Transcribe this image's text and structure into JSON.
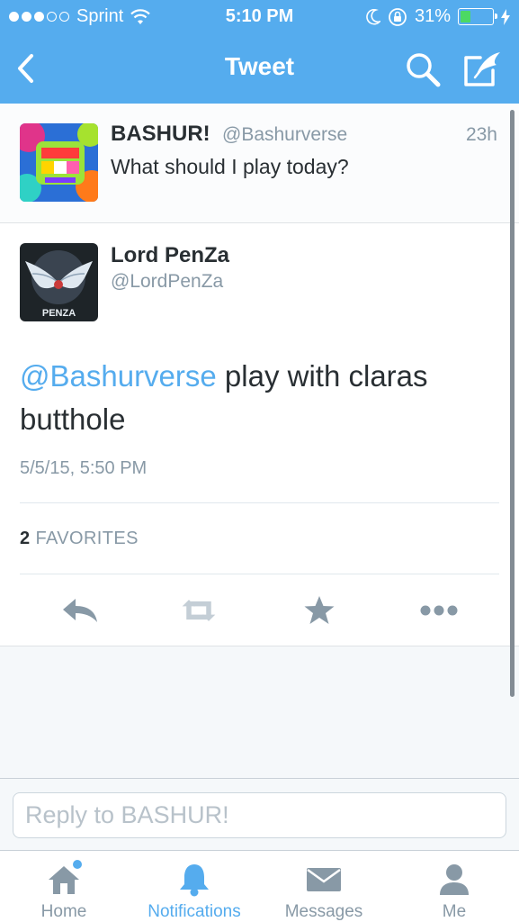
{
  "status_bar": {
    "carrier": "Sprint",
    "time": "5:10 PM",
    "battery": "31%",
    "battery_level": 0.31,
    "signal_bars_filled": 3,
    "signal_bars_total": 5,
    "icons": [
      "wifi-icon",
      "moon-icon",
      "rotation-lock-icon",
      "battery-icon",
      "charging-bolt-icon"
    ]
  },
  "nav": {
    "title": "Tweet",
    "icons": [
      "back-chevron-icon",
      "search-icon",
      "compose-icon"
    ]
  },
  "original_tweet": {
    "name": "BASHUR!",
    "handle": "@Bashurverse",
    "time_ago": "23h",
    "text": "What should I play today?"
  },
  "reply_tweet": {
    "name": "Lord PenZa",
    "handle": "@LordPenZa",
    "avatar_text": "PENZA",
    "mention": "@Bashurverse",
    "text": " play with claras butthole",
    "date": "5/5/15, 5:50 PM",
    "favorites_count": "2",
    "favorites_label": " FAVORITES",
    "action_icons": [
      "reply-icon",
      "retweet-icon",
      "favorite-star-icon",
      "more-icon"
    ]
  },
  "reply_bar": {
    "placeholder": "Reply to BASHUR!"
  },
  "tabs": [
    {
      "label": "Home",
      "icon": "home-icon",
      "active": false,
      "has_dot": true
    },
    {
      "label": "Notifications",
      "icon": "bell-icon",
      "active": true,
      "has_dot": false
    },
    {
      "label": "Messages",
      "icon": "envelope-icon",
      "active": false,
      "has_dot": false
    },
    {
      "label": "Me",
      "icon": "person-icon",
      "active": false,
      "has_dot": false
    }
  ],
  "colors": {
    "accent": "#55acee",
    "text": "#292f33",
    "muted": "#8899a6",
    "battery_green": "#4cd964"
  }
}
